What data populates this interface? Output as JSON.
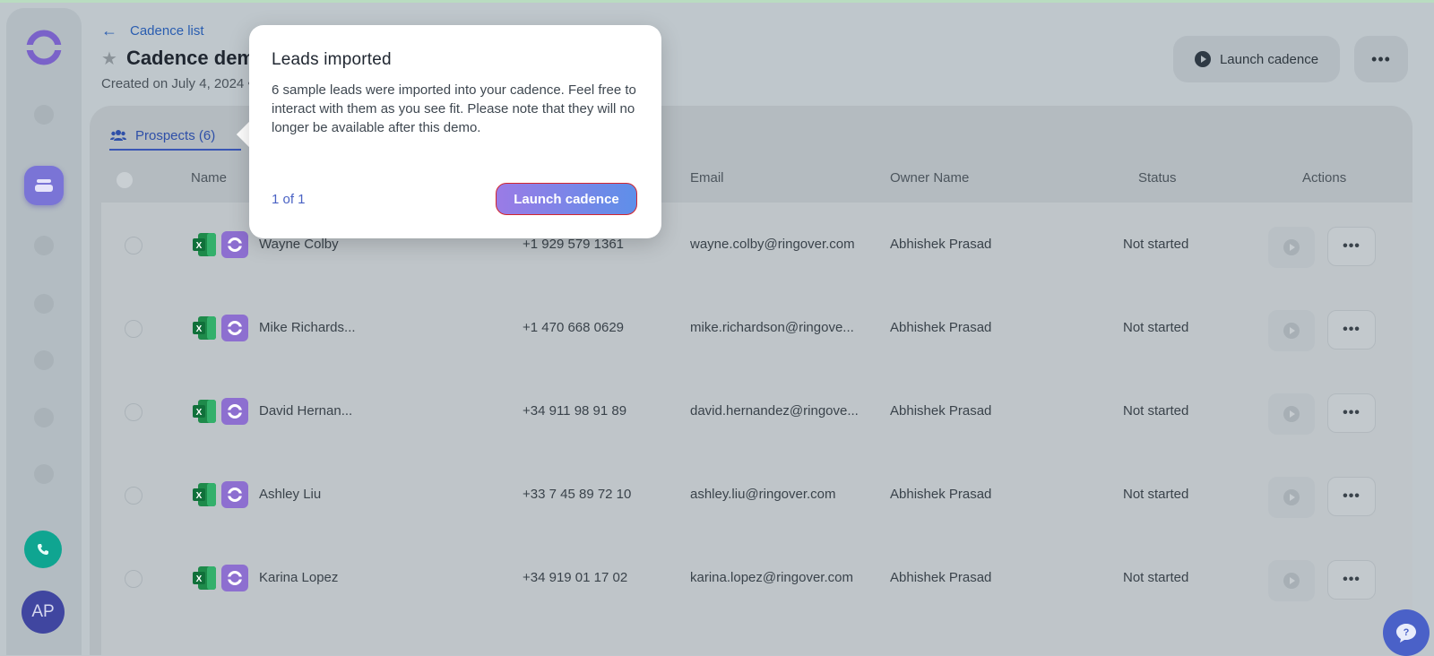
{
  "header": {
    "back_link_label": "Cadence list",
    "title": "Cadence dem",
    "subtitle": "Created on July 4, 2024 •",
    "launch_button_label": "Launch cadence",
    "more_button_label": "•••"
  },
  "sidebar": {
    "avatar_initials": "AP",
    "icons": [
      "logo-icon",
      "nav-dot-icon",
      "cadence-icon",
      "phone-icon"
    ]
  },
  "tabs": [
    {
      "label": "Prospects (6)",
      "active": true
    }
  ],
  "table": {
    "columns": [
      "Name",
      "Email",
      "Owner Name",
      "Status",
      "Actions"
    ],
    "rows": [
      {
        "name": "Wayne Colby",
        "phone": "+1 929 579 1361",
        "email": "wayne.colby@ringover.com",
        "owner": "Abhishek Prasad",
        "status": "Not started"
      },
      {
        "name": "Mike Richards...",
        "phone": "+1 470 668 0629",
        "email": "mike.richardson@ringove...",
        "owner": "Abhishek Prasad",
        "status": "Not started"
      },
      {
        "name": "David Hernan...",
        "phone": "+34 911 98 91 89",
        "email": "david.hernandez@ringove...",
        "owner": "Abhishek Prasad",
        "status": "Not started"
      },
      {
        "name": "Ashley Liu",
        "phone": "+33 7 45 89 72 10",
        "email": "ashley.liu@ringover.com",
        "owner": "Abhishek Prasad",
        "status": "Not started"
      },
      {
        "name": "Karina Lopez",
        "phone": "+34 919 01 17 02",
        "email": "karina.lopez@ringover.com",
        "owner": "Abhishek Prasad",
        "status": "Not started"
      }
    ]
  },
  "popover": {
    "title": "Leads imported",
    "body": "6 sample leads were imported into your cadence. Feel free to interact with them as you see fit. Please note that they will no longer be available after this demo.",
    "step": "1 of 1",
    "button_label": "Launch cadence"
  },
  "colors": {
    "accent": "#4a62c4",
    "popover_button_gradient": [
      "#9a7be6",
      "#5e8fe9"
    ],
    "phone_button": "#0fa591",
    "avatar": "#4046a0"
  }
}
